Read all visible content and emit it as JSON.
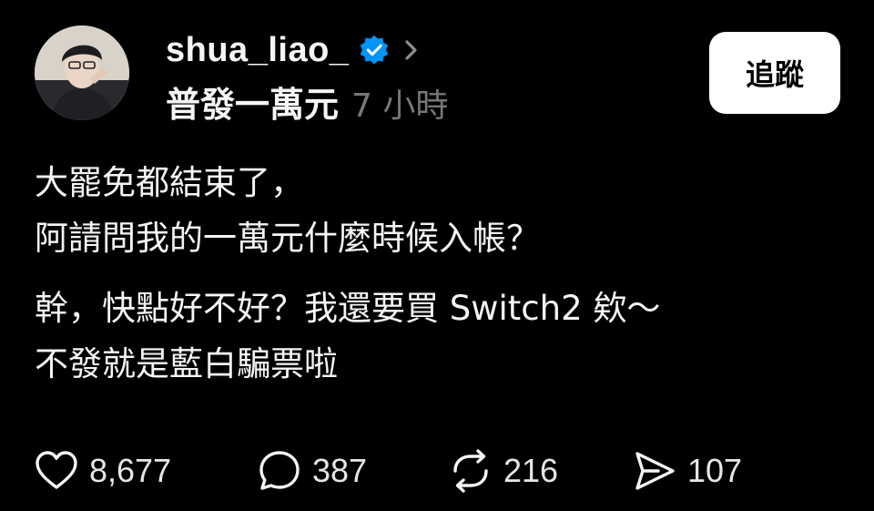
{
  "post": {
    "username": "shua_liao_",
    "topic": "普發一萬元",
    "time": "7 小時",
    "follow_label": "追蹤",
    "paragraph_1": "大罷免都結束了，\n阿請問我的一萬元什麼時候入帳？",
    "paragraph_2": "幹，快點好不好？我還要買 Switch2 欸～\n不發就是藍白騙票啦"
  },
  "actions": {
    "likes": "8,677",
    "comments": "387",
    "reposts": "216",
    "shares": "107"
  },
  "icons": {
    "verified": "verified-badge-icon",
    "chevron": "chevron-right-icon",
    "like": "heart-icon",
    "comment": "comment-bubble-icon",
    "repost": "repost-icon",
    "share": "send-icon"
  },
  "colors": {
    "background": "#000000",
    "text": "#f3f5f7",
    "muted": "#777777",
    "verified": "#0095f6",
    "follow_bg": "#ffffff"
  }
}
